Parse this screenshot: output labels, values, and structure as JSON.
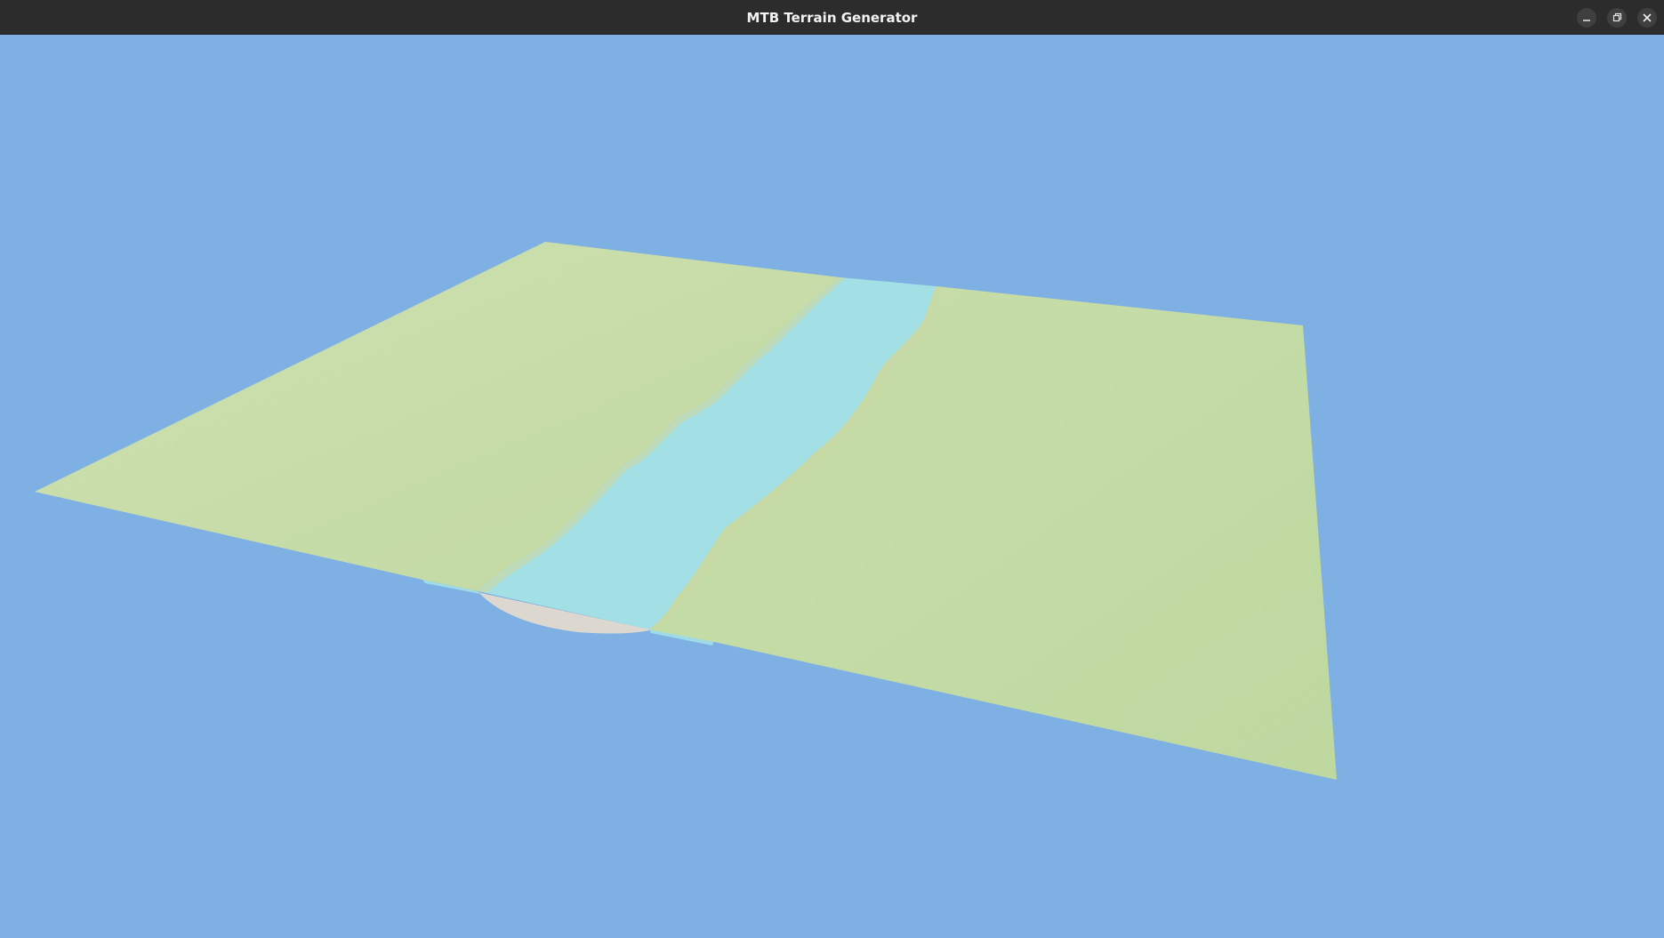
{
  "window": {
    "title": "MTB Terrain Generator",
    "controls": {
      "minimize_icon": "minimize-icon",
      "maximize_icon": "restore-icon",
      "close_icon": "close-icon"
    }
  },
  "scene": {
    "sky_color": "#7fb0e3",
    "grass_color": "#c4dba6",
    "water_color": "#a3dfe6",
    "bank_color": "#dfdcd2"
  }
}
